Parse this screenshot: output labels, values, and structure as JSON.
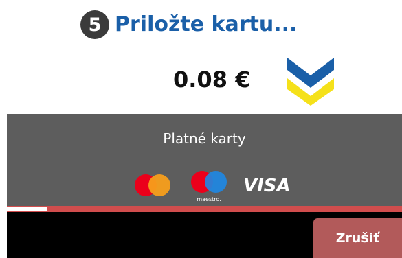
{
  "header": {
    "step_number": "5",
    "title": "Priložte kartu..."
  },
  "payment": {
    "amount": "0.08 €"
  },
  "cards": {
    "label": "Platné karty",
    "logos": [
      {
        "name": "mastercard",
        "text": ""
      },
      {
        "name": "maestro",
        "text": "maestro."
      },
      {
        "name": "visa",
        "text": "VISA"
      }
    ]
  },
  "progress": {
    "fraction": 0.1
  },
  "actions": {
    "cancel_label": "Zrušiť"
  },
  "colors": {
    "title_blue": "#1a5fa8",
    "chevron_blue": "#1a5fa8",
    "chevron_yellow": "#f5e11a",
    "panel_gray": "#5d5d5d",
    "progress_red": "#d14d4d",
    "cancel_button": "#b25a5a",
    "mastercard_red": "#eb001b",
    "mastercard_orange": "#f79e1b",
    "maestro_blue": "#1e88e5"
  }
}
